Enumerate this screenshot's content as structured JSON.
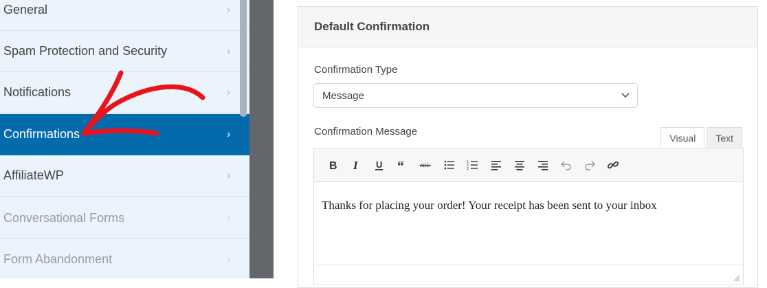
{
  "sidebar": {
    "items": [
      {
        "label": "General",
        "state": "normal"
      },
      {
        "label": "Spam Protection and Security",
        "state": "normal"
      },
      {
        "label": "Notifications",
        "state": "normal"
      },
      {
        "label": "Confirmations",
        "state": "active"
      },
      {
        "label": "AffiliateWP",
        "state": "normal"
      },
      {
        "label": "Conversational Forms",
        "state": "disabled"
      },
      {
        "label": "Form Abandonment",
        "state": "disabled"
      }
    ],
    "chevron": "›"
  },
  "panel": {
    "title": "Default Confirmation",
    "confirmation_type_label": "Confirmation Type",
    "confirmation_type_value": "Message",
    "confirmation_message_label": "Confirmation Message",
    "tabs": {
      "visual": "Visual",
      "text": "Text"
    },
    "toolbar_icons": [
      "bold-icon",
      "italic-icon",
      "underline-icon",
      "blockquote-icon",
      "strikethrough-icon",
      "bullet-list-icon",
      "numbered-list-icon",
      "align-left-icon",
      "align-center-icon",
      "align-right-icon",
      "undo-icon",
      "redo-icon",
      "link-icon"
    ],
    "message_text": "Thanks for placing your order! Your receipt has been sent to your inbox"
  },
  "colors": {
    "sidebar_bg": "#ebf3fc",
    "active_bg": "#036aab",
    "gutter": "#63666a",
    "annotation_arrow": "#e8141b"
  }
}
